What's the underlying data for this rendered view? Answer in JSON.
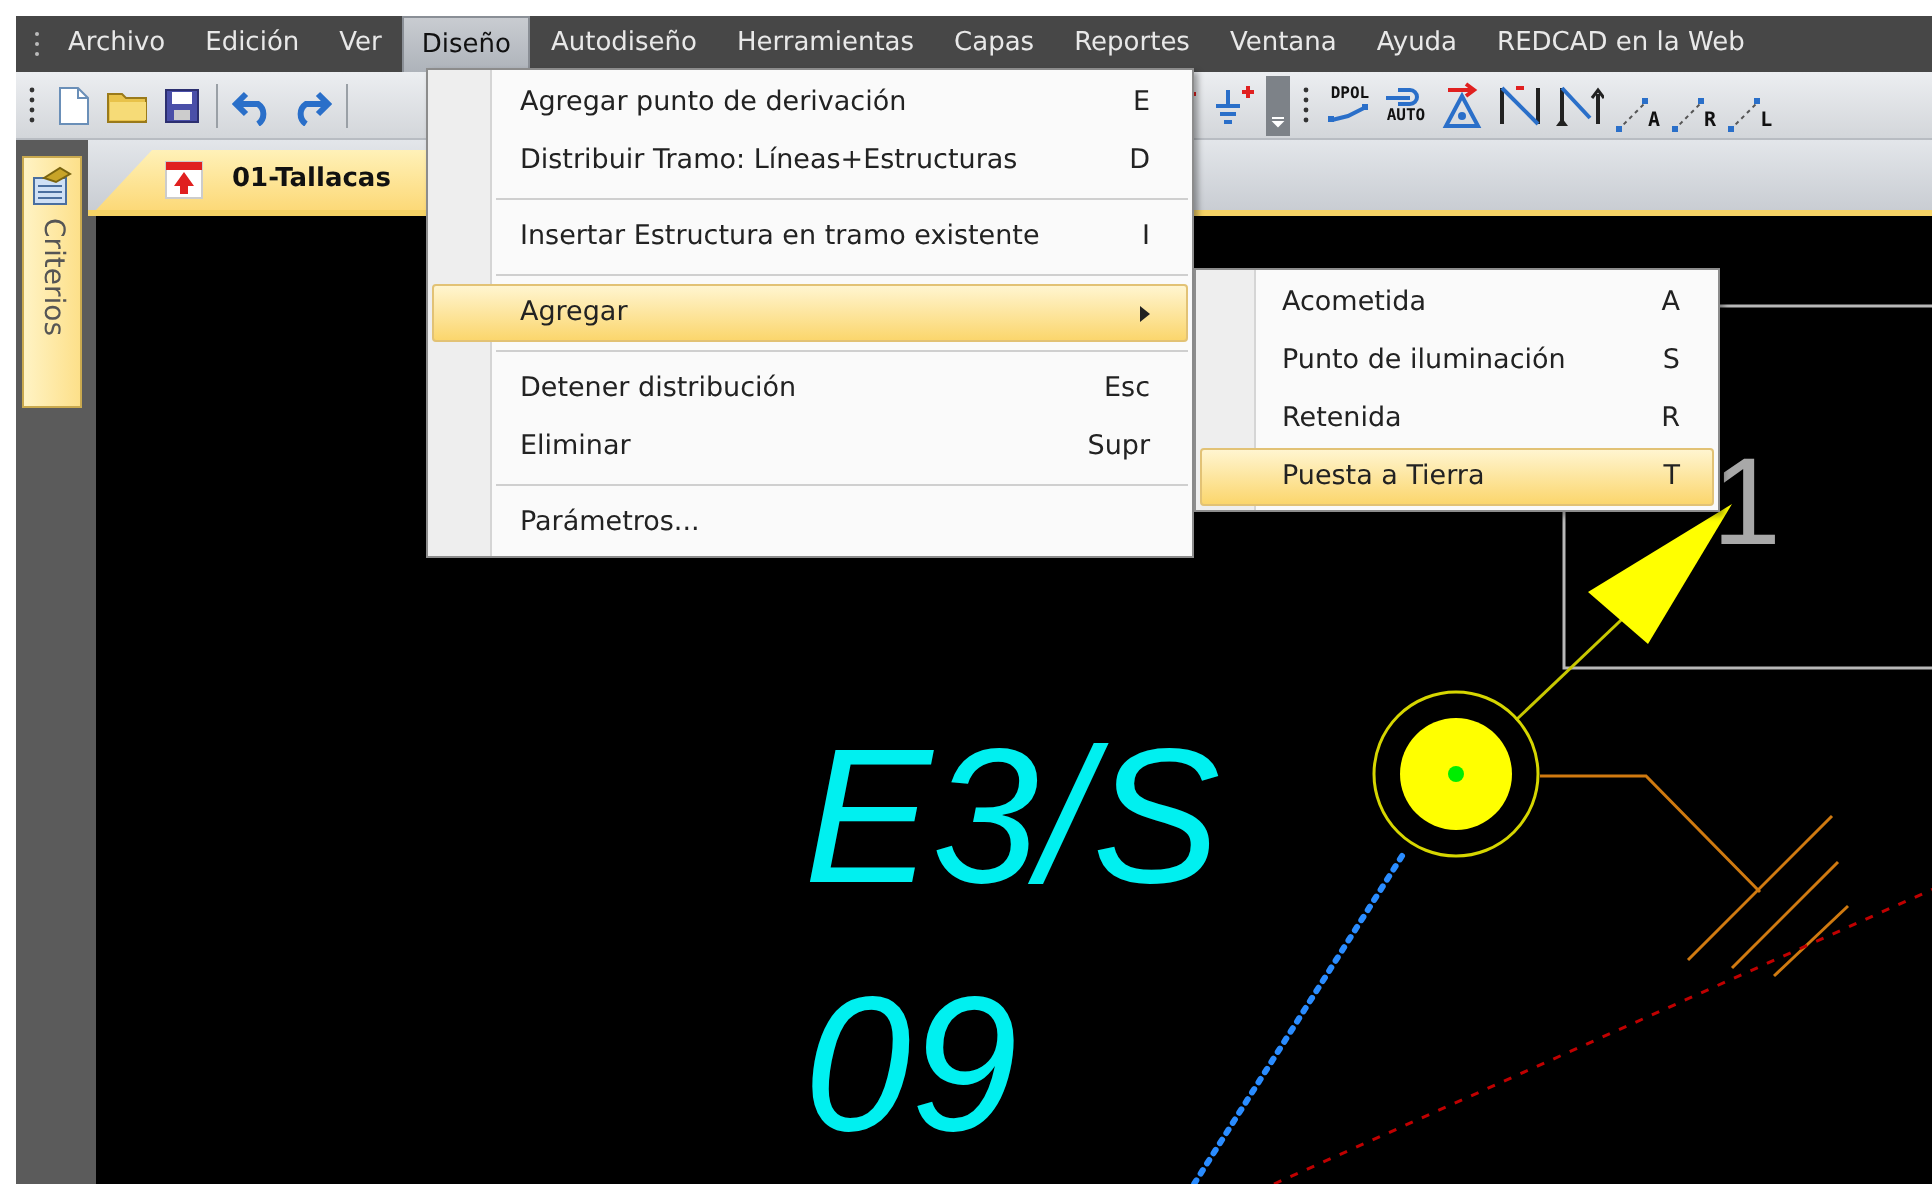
{
  "menubar": [
    {
      "label": "Archivo",
      "selected": false
    },
    {
      "label": "Edición",
      "selected": false
    },
    {
      "label": "Ver",
      "selected": false
    },
    {
      "label": "Diseño",
      "selected": true
    },
    {
      "label": "Autodiseño",
      "selected": false
    },
    {
      "label": "Herramientas",
      "selected": false
    },
    {
      "label": "Capas",
      "selected": false
    },
    {
      "label": "Reportes",
      "selected": false
    },
    {
      "label": "Ventana",
      "selected": false
    },
    {
      "label": "Ayuda",
      "selected": false
    },
    {
      "label": "REDCAD en la Web",
      "selected": false
    }
  ],
  "toolbar": {
    "dpol_label": "DPOL",
    "auto_label": "AUTO",
    "span_labels": [
      "A",
      "R",
      "L"
    ]
  },
  "side_panel": {
    "title": "Criterios"
  },
  "document_tab": {
    "title": "01-Tallacas"
  },
  "menu": [
    {
      "kind": "item",
      "label": "Agregar punto de derivación",
      "shortcut": "E",
      "selected": false
    },
    {
      "kind": "item",
      "label": "Distribuir Tramo: Líneas+Estructuras",
      "shortcut": "D",
      "selected": false
    },
    {
      "kind": "separator"
    },
    {
      "kind": "item",
      "label": "Insertar Estructura en tramo existente",
      "shortcut": "I",
      "selected": false
    },
    {
      "kind": "separator"
    },
    {
      "kind": "submenu",
      "label": "Agregar",
      "selected": true
    },
    {
      "kind": "separator"
    },
    {
      "kind": "item",
      "label": "Detener distribución",
      "shortcut": "Esc",
      "selected": false
    },
    {
      "kind": "item",
      "label": "Eliminar",
      "shortcut": "Supr",
      "selected": false
    },
    {
      "kind": "separator"
    },
    {
      "kind": "item",
      "label": "Parámetros...",
      "selected": false
    }
  ],
  "submenu": [
    {
      "label": "Acometida",
      "shortcut": "A",
      "selected": false
    },
    {
      "label": "Punto de iluminación",
      "shortcut": "S",
      "selected": false
    },
    {
      "label": "Retenida",
      "shortcut": "R",
      "selected": false
    },
    {
      "label": "Puesta a Tierra",
      "shortcut": "T",
      "selected": true
    }
  ],
  "drawing": {
    "structure_labels": [
      "E3/S",
      "09"
    ],
    "box_label": "1"
  }
}
